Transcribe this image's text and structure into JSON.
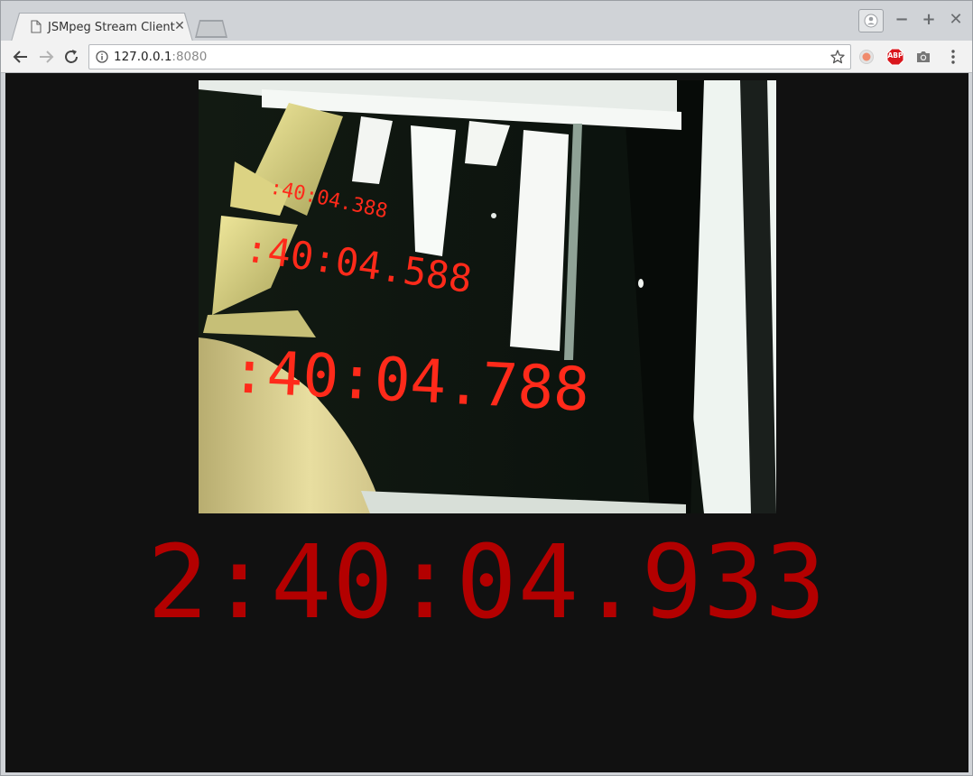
{
  "browser": {
    "tab_title": "JSMpeg Stream Client",
    "url_host": "127.0.0.1",
    "url_port": ":8080",
    "extensions": [
      "record-icon",
      "adblock-icon",
      "camera-icon"
    ],
    "adblock_label": "ABP"
  },
  "page": {
    "clock_text": "2:40:04.933",
    "clock_color": "#b30000",
    "background_color": "#111111",
    "video_frame": {
      "visible_timestamps": [
        ":40:04.388",
        ":40:04.588",
        ":40:04.788"
      ],
      "timestamp_color": "#ff2a1a"
    }
  }
}
